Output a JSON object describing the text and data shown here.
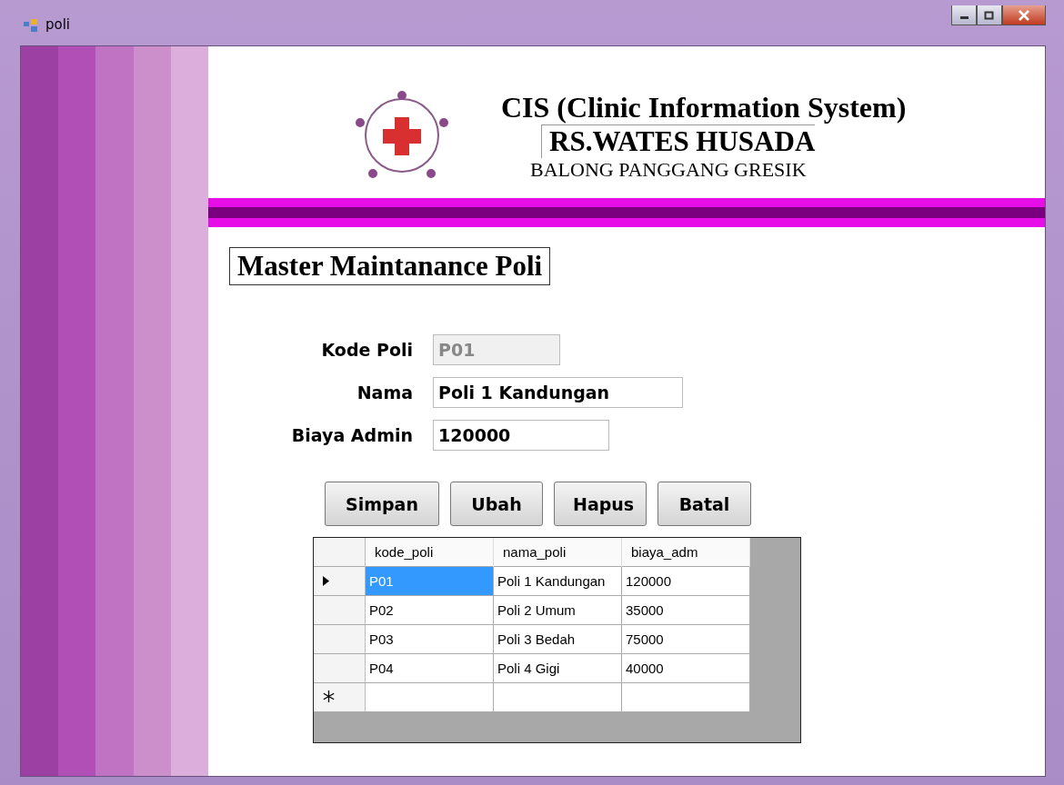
{
  "window": {
    "title": "poli"
  },
  "header": {
    "title": "CIS (Clinic Information System)",
    "hospital": "RS.WATES HUSADA",
    "address": "BALONG PANGGANG GRESIK"
  },
  "form_title": "Master Maintanance Poli",
  "fields": [
    {
      "label": "Kode Poli",
      "value": "P01",
      "disabled": true
    },
    {
      "label": "Nama",
      "value": "Poli 1 Kandungan",
      "disabled": false
    },
    {
      "label": "Biaya Admin",
      "value": "120000",
      "disabled": false
    }
  ],
  "buttons": [
    "Simpan",
    "Ubah",
    "Hapus",
    "Batal"
  ],
  "table": {
    "columns": [
      "kode_poli",
      "nama_poli",
      "biaya_adm"
    ],
    "rows": [
      {
        "kind": "data",
        "selected": true,
        "cells": [
          "P01",
          "Poli 1 Kandungan",
          "120000"
        ]
      },
      {
        "kind": "data",
        "selected": false,
        "cells": [
          "P02",
          "Poli 2 Umum",
          "35000"
        ]
      },
      {
        "kind": "data",
        "selected": false,
        "cells": [
          "P03",
          "Poli 3 Bedah",
          "75000"
        ]
      },
      {
        "kind": "data",
        "selected": false,
        "cells": [
          "P04",
          "Poli 4 Gigi",
          "40000"
        ]
      },
      {
        "kind": "new",
        "selected": false,
        "cells": [
          "",
          "",
          ""
        ]
      }
    ]
  }
}
